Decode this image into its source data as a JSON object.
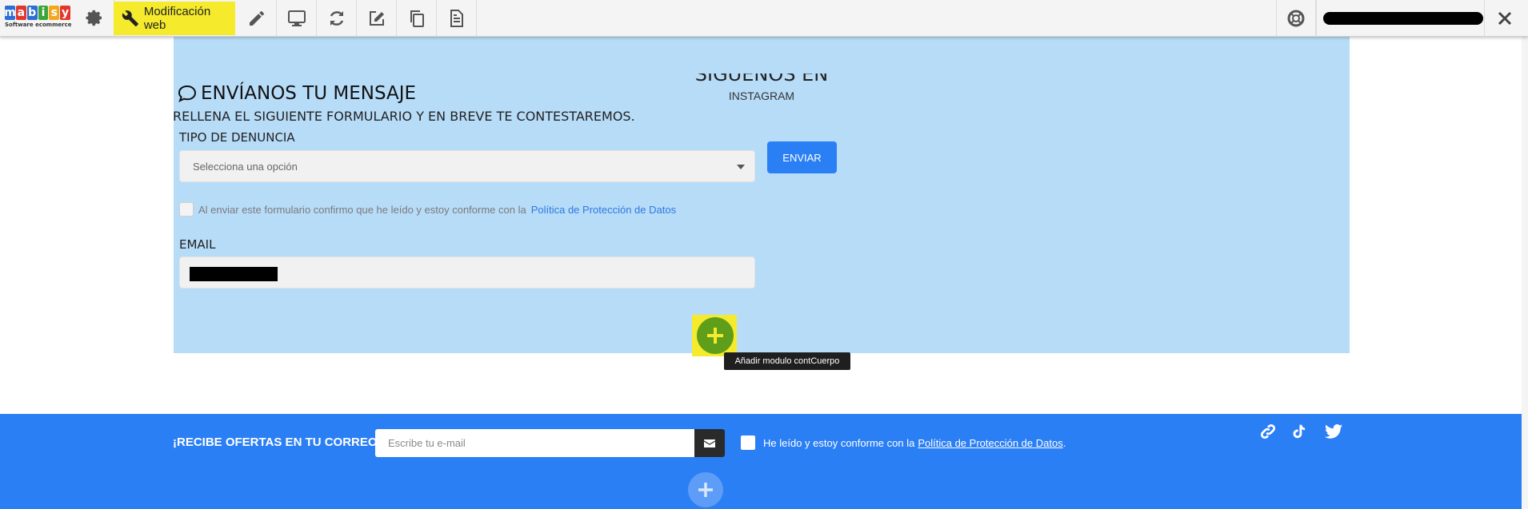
{
  "toolbar": {
    "logo_letters": [
      "m",
      "a",
      "b",
      "i",
      "s",
      "y"
    ],
    "logo_tagline": "Software ecommerce",
    "web_edit_label": "Modificación web",
    "icons": [
      "gear-icon",
      "wrench-icon",
      "pencil-icon",
      "monitor-icon",
      "refresh-icon",
      "edit-icon",
      "copy-icon",
      "document-icon",
      "lifebuoy-icon",
      "close-icon"
    ],
    "highlight_color": "#f5ea2c"
  },
  "section": {
    "follow_title": "SÍGUENOS EN",
    "follow_sub": "INSTAGRAM",
    "message_title": "ENVÍANOS TU MENSAJE",
    "message_subtitle": "RELLENA EL SIGUIENTE FORMULARIO Y EN BREVE TE CONTESTAREMOS.",
    "type_label": "TIPO DE DENUNCIA",
    "select_value": "Selecciona una opción",
    "send_label": "ENVIAR",
    "consent_text": "Al enviar este formulario confirmo que he leído y estoy conforme con la",
    "consent_link": "Política de Protección de Datos",
    "email_label": "EMAIL",
    "add_tooltip": "Añadir modulo contCuerpo",
    "bg_color": "#b7dcf8",
    "accent": "#2b7ff5"
  },
  "footer": {
    "title": "¡RECIBE OFERTAS EN TU CORREO!",
    "email_placeholder": "Escribe tu e-mail",
    "consent_text": "He leído y estoy conforme con la",
    "consent_link": "Política de Protección de Datos",
    "consent_end": ".",
    "social_icons": [
      "link-icon",
      "tiktok-icon",
      "twitter-icon"
    ],
    "bg_color": "#2b7ff5"
  }
}
